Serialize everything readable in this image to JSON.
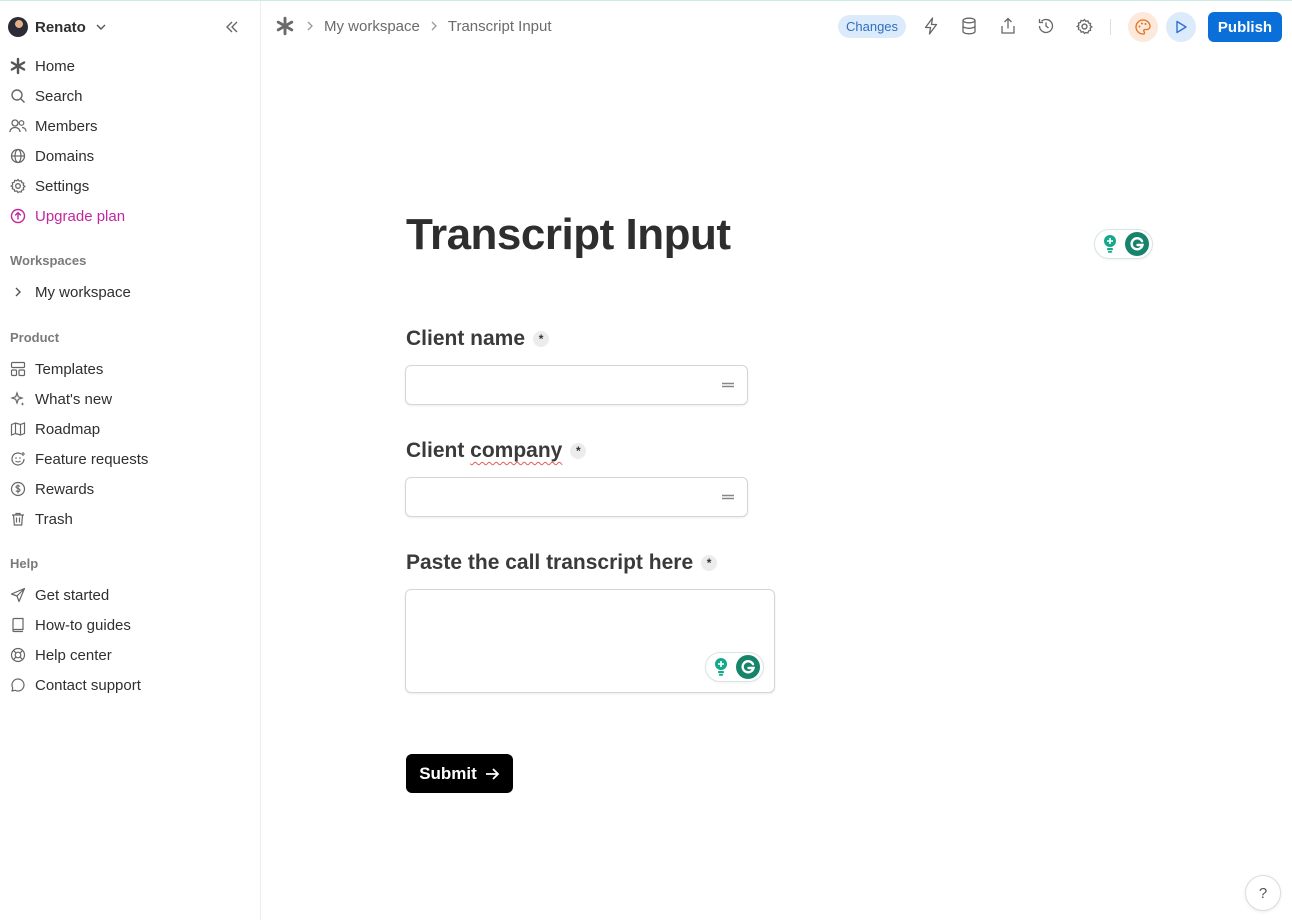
{
  "user": {
    "name": "Renato"
  },
  "sidebar": {
    "main_items": [
      {
        "label": "Home",
        "icon": "asterisk-icon"
      },
      {
        "label": "Search",
        "icon": "search-icon"
      },
      {
        "label": "Members",
        "icon": "members-icon"
      },
      {
        "label": "Domains",
        "icon": "globe-icon"
      },
      {
        "label": "Settings",
        "icon": "gear-icon"
      },
      {
        "label": "Upgrade plan",
        "icon": "upgrade-icon",
        "color": "#c2279e"
      }
    ],
    "workspaces_label": "Workspaces",
    "workspaces": [
      {
        "label": "My workspace",
        "icon": "chevron-right-icon"
      }
    ],
    "product_label": "Product",
    "product_items": [
      {
        "label": "Templates",
        "icon": "templates-icon"
      },
      {
        "label": "What's new",
        "icon": "sparkle-icon"
      },
      {
        "label": "Roadmap",
        "icon": "map-icon"
      },
      {
        "label": "Feature requests",
        "icon": "feature-request-icon"
      },
      {
        "label": "Rewards",
        "icon": "dollar-icon"
      },
      {
        "label": "Trash",
        "icon": "trash-icon"
      }
    ],
    "help_label": "Help",
    "help_items": [
      {
        "label": "Get started",
        "icon": "send-icon"
      },
      {
        "label": "How-to guides",
        "icon": "book-icon"
      },
      {
        "label": "Help center",
        "icon": "lifebuoy-icon"
      },
      {
        "label": "Contact support",
        "icon": "chat-icon"
      }
    ]
  },
  "topbar": {
    "breadcrumbs": [
      "My workspace",
      "Transcript Input"
    ],
    "changes_label": "Changes",
    "publish_label": "Publish",
    "accent": "#0a6fd8"
  },
  "form": {
    "title": "Transcript Input",
    "required_mark": "*",
    "fields": [
      {
        "label": "Client name",
        "value": ""
      },
      {
        "label": "Client company",
        "value": ""
      },
      {
        "label": "Paste the call transcript here",
        "value": ""
      }
    ],
    "submit_label": "Submit"
  },
  "help_button": "?"
}
